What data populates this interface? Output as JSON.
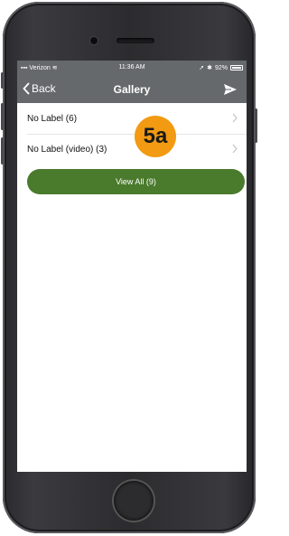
{
  "status_bar": {
    "carrier": "Verizon",
    "time": "11:36 AM",
    "battery": "92%"
  },
  "nav": {
    "back_label": "Back",
    "title": "Gallery"
  },
  "gallery": {
    "items": [
      {
        "label": "No Label (6)"
      },
      {
        "label": "No Label (video) (3)"
      }
    ],
    "view_all_label": "View All (9)"
  },
  "annotation": {
    "badge": "5a"
  },
  "colors": {
    "nav_bg": "#66696c",
    "button_bg": "#4a7a2c",
    "badge_bg": "#f29a12"
  },
  "icons": [
    "back-chevron-icon",
    "send-icon",
    "chevron-right-icon",
    "wifi-icon",
    "location-icon",
    "bluetooth-icon",
    "battery-icon"
  ]
}
